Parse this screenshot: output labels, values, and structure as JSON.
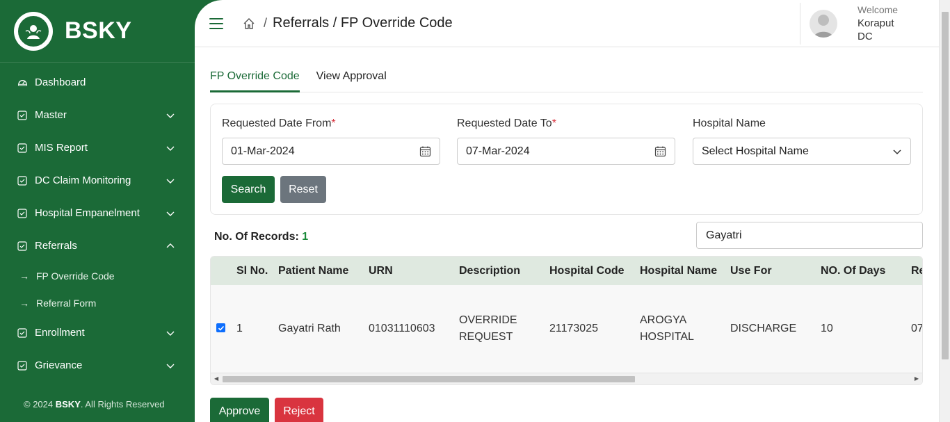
{
  "brand": {
    "name": "BSKY"
  },
  "sidebar": {
    "items": [
      {
        "label": "Dashboard",
        "icon": "gauge-icon",
        "expandable": false
      },
      {
        "label": "Master",
        "icon": "check-square-icon",
        "expandable": true
      },
      {
        "label": "MIS Report",
        "icon": "check-square-icon",
        "expandable": true
      },
      {
        "label": "DC Claim Monitoring",
        "icon": "check-square-icon",
        "expandable": true
      },
      {
        "label": "Hospital Empanelment",
        "icon": "check-square-icon",
        "expandable": true
      },
      {
        "label": "Referrals",
        "icon": "check-square-icon",
        "expandable": true,
        "expanded": true
      },
      {
        "label": "Enrollment",
        "icon": "check-square-icon",
        "expandable": true
      },
      {
        "label": "Grievance",
        "icon": "check-square-icon",
        "expandable": true
      }
    ],
    "sub_items": [
      {
        "label": "FP Override Code",
        "icon": "arrow-right-icon"
      },
      {
        "label": "Referral Form",
        "icon": "arrow-right-icon"
      }
    ],
    "copyright_prefix": "© 2024",
    "copyright_brand": "BSKY",
    "copyright_suffix": ". All Rights Reserved"
  },
  "header": {
    "breadcrumb_sep": "/",
    "breadcrumb": "Referrals / FP Override Code",
    "welcome": "Welcome",
    "user_line1": "Koraput",
    "user_line2": "DC"
  },
  "tabs": [
    {
      "label": "FP Override Code",
      "active": true
    },
    {
      "label": "View Approval",
      "active": false
    }
  ],
  "filters": {
    "date_from_label": "Requested Date From",
    "date_from_value": "01-Mar-2024",
    "date_to_label": "Requested Date To",
    "date_to_value": "07-Mar-2024",
    "required_mark": "*",
    "hospital_label": "Hospital Name",
    "hospital_value": "Select Hospital Name",
    "search_label": "Search",
    "reset_label": "Reset"
  },
  "records": {
    "label": "No. Of Records:",
    "count": "1"
  },
  "search": {
    "value": "Gayatri"
  },
  "table": {
    "columns": [
      "Sl No.",
      "Patient Name",
      "URN",
      "Description",
      "Hospital Code",
      "Hospital Name",
      "Use For",
      "NO. Of Days",
      "Re"
    ],
    "rows": [
      {
        "checked": true,
        "sl": "1",
        "patient": "Gayatri Rath",
        "urn": "01031110603",
        "desc1": "OVERRIDE",
        "desc2": "REQUEST",
        "hcode": "21173025",
        "hname1": "AROGYA",
        "hname2": "HOSPITAL",
        "use_for": "DISCHARGE",
        "days": "10",
        "req": "07"
      }
    ]
  },
  "actions": {
    "approve_label": "Approve",
    "reject_label": "Reject"
  },
  "colors": {
    "brand_green": "#1b6a37",
    "table_header": "#dfe9e0",
    "reject_red": "#d9343f",
    "reset_gray": "#6c757d",
    "checkbox_blue": "#0d6efd"
  }
}
